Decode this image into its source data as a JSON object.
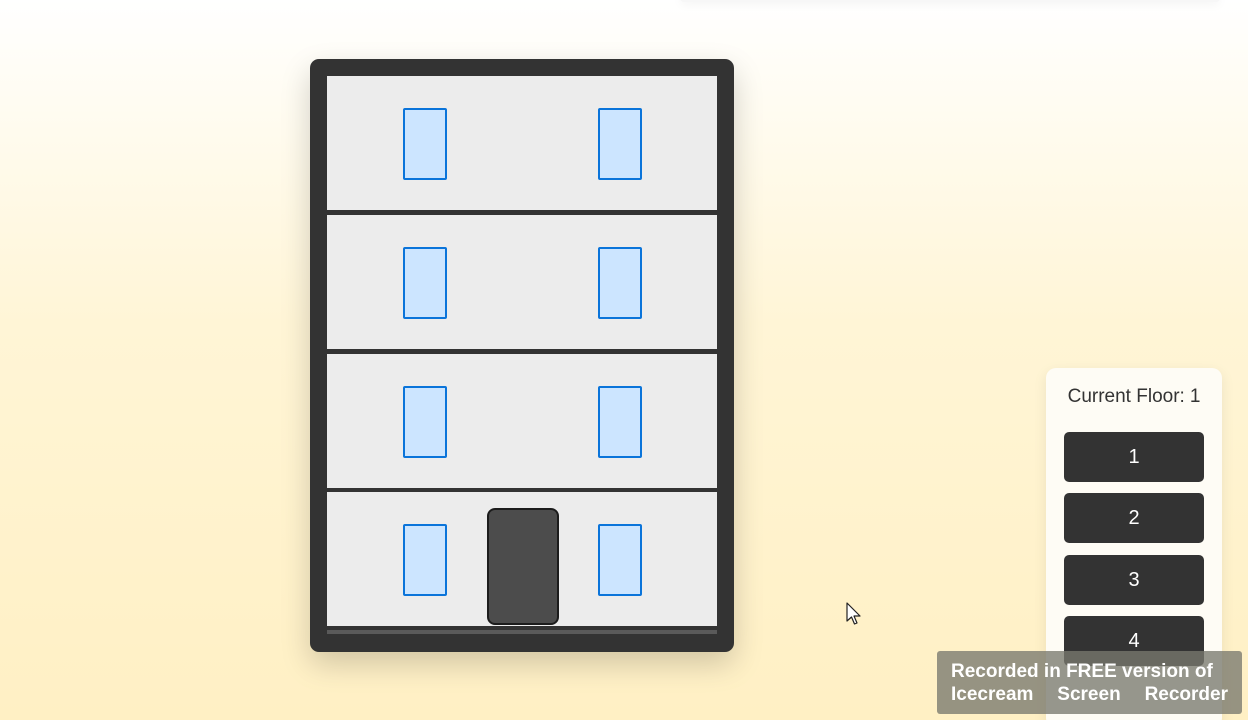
{
  "building": {
    "floors": [
      4,
      3,
      2,
      1
    ],
    "elevator_floor": 1
  },
  "panel": {
    "title_label": "Current Floor:",
    "current_floor": "1",
    "buttons": [
      "1",
      "2",
      "3",
      "4"
    ]
  },
  "watermark": {
    "line1": "Recorded in FREE version of",
    "line2_words": [
      "Icecream",
      "Screen",
      "Recorder"
    ]
  },
  "colors": {
    "building_frame": "#333333",
    "floor_bg": "#ececec",
    "window_fill": "#cce5ff",
    "window_border": "#0a74da",
    "elevator": "#4c4c4c",
    "button_bg": "#333333",
    "button_text": "#ffffff"
  },
  "icons": {
    "cursor": "mouse-pointer-icon"
  }
}
